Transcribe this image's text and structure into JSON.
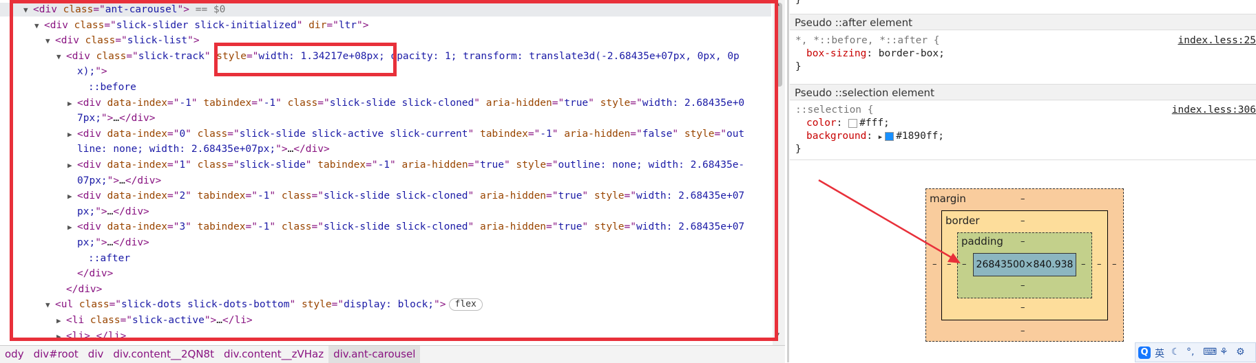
{
  "elements": {
    "lines": [
      {
        "indent": 1,
        "arrow": "down",
        "selected": true,
        "html": [
          [
            "t",
            "<div "
          ],
          [
            "an",
            "class"
          ],
          [
            "t",
            "=\""
          ],
          [
            "av",
            "ant-carousel"
          ],
          [
            "t",
            "\">"
          ],
          [
            "dim",
            " == $0"
          ]
        ]
      },
      {
        "indent": 2,
        "arrow": "down",
        "html": [
          [
            "t",
            "<div "
          ],
          [
            "an",
            "class"
          ],
          [
            "t",
            "=\""
          ],
          [
            "av",
            "slick-slider slick-initialized"
          ],
          [
            "t",
            "\" "
          ],
          [
            "an",
            "dir"
          ],
          [
            "t",
            "=\""
          ],
          [
            "av",
            "ltr"
          ],
          [
            "t",
            "\">"
          ]
        ]
      },
      {
        "indent": 3,
        "arrow": "down",
        "html": [
          [
            "t",
            "<div "
          ],
          [
            "an",
            "class"
          ],
          [
            "t",
            "=\""
          ],
          [
            "av",
            "slick-list"
          ],
          [
            "t",
            "\">"
          ]
        ]
      },
      {
        "indent": 4,
        "arrow": "down",
        "html": [
          [
            "t",
            "<div "
          ],
          [
            "an",
            "class"
          ],
          [
            "t",
            "=\""
          ],
          [
            "av",
            "slick-track"
          ],
          [
            "t",
            "\" "
          ],
          [
            "an",
            "style"
          ],
          [
            "t",
            "=\""
          ],
          [
            "av",
            "width: 1.34217e+08px; opacity: 1; transform: translate3d(-2.68435e+07px, 0px, 0p"
          ]
        ]
      },
      {
        "indent": 5,
        "arrow": "none",
        "html": [
          [
            "av",
            "x);"
          ],
          [
            "t",
            "\">"
          ]
        ]
      },
      {
        "indent": 6,
        "arrow": "none",
        "html": [
          [
            "ps",
            "::before"
          ]
        ]
      },
      {
        "indent": 5,
        "arrow": "right",
        "html": [
          [
            "t",
            "<div "
          ],
          [
            "an",
            "data-index"
          ],
          [
            "t",
            "=\""
          ],
          [
            "av",
            "-1"
          ],
          [
            "t",
            "\" "
          ],
          [
            "an",
            "tabindex"
          ],
          [
            "t",
            "=\""
          ],
          [
            "av",
            "-1"
          ],
          [
            "t",
            "\" "
          ],
          [
            "an",
            "class"
          ],
          [
            "t",
            "=\""
          ],
          [
            "av",
            "slick-slide slick-cloned"
          ],
          [
            "t",
            "\" "
          ],
          [
            "an",
            "aria-hidden"
          ],
          [
            "t",
            "=\""
          ],
          [
            "av",
            "true"
          ],
          [
            "t",
            "\" "
          ],
          [
            "an",
            "style"
          ],
          [
            "t",
            "=\""
          ],
          [
            "av",
            "width: 2.68435e+0"
          ]
        ]
      },
      {
        "indent": 5,
        "arrow": "none",
        "html": [
          [
            "av",
            "7px;"
          ],
          [
            "t",
            "\">"
          ],
          [
            "ell",
            "…"
          ],
          [
            "t",
            "</div>"
          ]
        ]
      },
      {
        "indent": 5,
        "arrow": "right",
        "html": [
          [
            "t",
            "<div "
          ],
          [
            "an",
            "data-index"
          ],
          [
            "t",
            "=\""
          ],
          [
            "av",
            "0"
          ],
          [
            "t",
            "\" "
          ],
          [
            "an",
            "class"
          ],
          [
            "t",
            "=\""
          ],
          [
            "av",
            "slick-slide slick-active slick-current"
          ],
          [
            "t",
            "\" "
          ],
          [
            "an",
            "tabindex"
          ],
          [
            "t",
            "=\""
          ],
          [
            "av",
            "-1"
          ],
          [
            "t",
            "\" "
          ],
          [
            "an",
            "aria-hidden"
          ],
          [
            "t",
            "=\""
          ],
          [
            "av",
            "false"
          ],
          [
            "t",
            "\" "
          ],
          [
            "an",
            "style"
          ],
          [
            "t",
            "=\""
          ],
          [
            "av",
            "out"
          ]
        ]
      },
      {
        "indent": 5,
        "arrow": "none",
        "html": [
          [
            "av",
            "line: none; width: 2.68435e+07px;"
          ],
          [
            "t",
            "\">"
          ],
          [
            "ell",
            "…"
          ],
          [
            "t",
            "</div>"
          ]
        ]
      },
      {
        "indent": 5,
        "arrow": "right",
        "html": [
          [
            "t",
            "<div "
          ],
          [
            "an",
            "data-index"
          ],
          [
            "t",
            "=\""
          ],
          [
            "av",
            "1"
          ],
          [
            "t",
            "\" "
          ],
          [
            "an",
            "class"
          ],
          [
            "t",
            "=\""
          ],
          [
            "av",
            "slick-slide"
          ],
          [
            "t",
            "\" "
          ],
          [
            "an",
            "tabindex"
          ],
          [
            "t",
            "=\""
          ],
          [
            "av",
            "-1"
          ],
          [
            "t",
            "\" "
          ],
          [
            "an",
            "aria-hidden"
          ],
          [
            "t",
            "=\""
          ],
          [
            "av",
            "true"
          ],
          [
            "t",
            "\" "
          ],
          [
            "an",
            "style"
          ],
          [
            "t",
            "=\""
          ],
          [
            "av",
            "outline: none; width: 2.68435e-"
          ]
        ]
      },
      {
        "indent": 5,
        "arrow": "none",
        "html": [
          [
            "av",
            "07px;"
          ],
          [
            "t",
            "\">"
          ],
          [
            "ell",
            "…"
          ],
          [
            "t",
            "</div>"
          ]
        ]
      },
      {
        "indent": 5,
        "arrow": "right",
        "html": [
          [
            "t",
            "<div "
          ],
          [
            "an",
            "data-index"
          ],
          [
            "t",
            "=\""
          ],
          [
            "av",
            "2"
          ],
          [
            "t",
            "\" "
          ],
          [
            "an",
            "tabindex"
          ],
          [
            "t",
            "=\""
          ],
          [
            "av",
            "-1"
          ],
          [
            "t",
            "\" "
          ],
          [
            "an",
            "class"
          ],
          [
            "t",
            "=\""
          ],
          [
            "av",
            "slick-slide slick-cloned"
          ],
          [
            "t",
            "\" "
          ],
          [
            "an",
            "aria-hidden"
          ],
          [
            "t",
            "=\""
          ],
          [
            "av",
            "true"
          ],
          [
            "t",
            "\" "
          ],
          [
            "an",
            "style"
          ],
          [
            "t",
            "=\""
          ],
          [
            "av",
            "width: 2.68435e+07"
          ]
        ]
      },
      {
        "indent": 5,
        "arrow": "none",
        "html": [
          [
            "av",
            "px;"
          ],
          [
            "t",
            "\">"
          ],
          [
            "ell",
            "…"
          ],
          [
            "t",
            "</div>"
          ]
        ]
      },
      {
        "indent": 5,
        "arrow": "right",
        "html": [
          [
            "t",
            "<div "
          ],
          [
            "an",
            "data-index"
          ],
          [
            "t",
            "=\""
          ],
          [
            "av",
            "3"
          ],
          [
            "t",
            "\" "
          ],
          [
            "an",
            "tabindex"
          ],
          [
            "t",
            "=\""
          ],
          [
            "av",
            "-1"
          ],
          [
            "t",
            "\" "
          ],
          [
            "an",
            "class"
          ],
          [
            "t",
            "=\""
          ],
          [
            "av",
            "slick-slide slick-cloned"
          ],
          [
            "t",
            "\" "
          ],
          [
            "an",
            "aria-hidden"
          ],
          [
            "t",
            "=\""
          ],
          [
            "av",
            "true"
          ],
          [
            "t",
            "\" "
          ],
          [
            "an",
            "style"
          ],
          [
            "t",
            "=\""
          ],
          [
            "av",
            "width: 2.68435e+07"
          ]
        ]
      },
      {
        "indent": 5,
        "arrow": "none",
        "html": [
          [
            "av",
            "px;"
          ],
          [
            "t",
            "\">"
          ],
          [
            "ell",
            "…"
          ],
          [
            "t",
            "</div>"
          ]
        ]
      },
      {
        "indent": 6,
        "arrow": "none",
        "html": [
          [
            "ps",
            "::after"
          ]
        ]
      },
      {
        "indent": 5,
        "arrow": "none",
        "html": [
          [
            "t",
            "</div>"
          ]
        ]
      },
      {
        "indent": 4,
        "arrow": "none",
        "html": [
          [
            "t",
            "</div>"
          ]
        ]
      },
      {
        "indent": 3,
        "arrow": "down",
        "flex": "flex",
        "html": [
          [
            "t",
            "<ul "
          ],
          [
            "an",
            "class"
          ],
          [
            "t",
            "=\""
          ],
          [
            "av",
            "slick-dots slick-dots-bottom"
          ],
          [
            "t",
            "\" "
          ],
          [
            "an",
            "style"
          ],
          [
            "t",
            "=\""
          ],
          [
            "av",
            "display: block;"
          ],
          [
            "t",
            "\">"
          ]
        ]
      },
      {
        "indent": 4,
        "arrow": "right",
        "html": [
          [
            "t",
            "<li "
          ],
          [
            "an",
            "class"
          ],
          [
            "t",
            "=\""
          ],
          [
            "av",
            "slick-active"
          ],
          [
            "t",
            "\">"
          ],
          [
            "ell",
            "…"
          ],
          [
            "t",
            "</li>"
          ]
        ]
      },
      {
        "indent": 4,
        "arrow": "right",
        "html": [
          [
            "t",
            "<li>"
          ],
          [
            "ell",
            "…"
          ],
          [
            "t",
            "</li>"
          ]
        ]
      }
    ]
  },
  "breadcrumb": [
    {
      "label": "ody",
      "active": false
    },
    {
      "label": "div#root",
      "active": false
    },
    {
      "label": "div",
      "active": false
    },
    {
      "label": "div.content__2QN8t",
      "active": false
    },
    {
      "label": "div.content__zVHaz",
      "active": false
    },
    {
      "label": "div.ant-carousel",
      "active": true
    }
  ],
  "styles": {
    "top_brace": "}",
    "after_header": "Pseudo ::after element",
    "after_rule": {
      "selector": "*, *::before, *::after {",
      "source": "index.less:25",
      "prop": "box-sizing",
      "value": "border-box;",
      "close": "}"
    },
    "selection_header": "Pseudo ::selection element",
    "selection_rule": {
      "selector": "::selection {",
      "source": "index.less:306",
      "color_prop": "color",
      "color_value": "#fff;",
      "color_swatch": "#ffffff",
      "bg_prop": "background",
      "bg_value": "#1890ff;",
      "bg_swatch": "#1890ff",
      "close": "}"
    }
  },
  "box_model": {
    "margin_label": "margin",
    "border_label": "border",
    "padding_label": "padding",
    "dash": "–",
    "content_size": "26843500×840.938"
  },
  "ime": {
    "logo": "Q",
    "lang": "英",
    "items": [
      "☾",
      "°,",
      "⌨",
      "⚘",
      "⚙"
    ]
  },
  "colors": {
    "annotation_red": "#e8303a"
  }
}
